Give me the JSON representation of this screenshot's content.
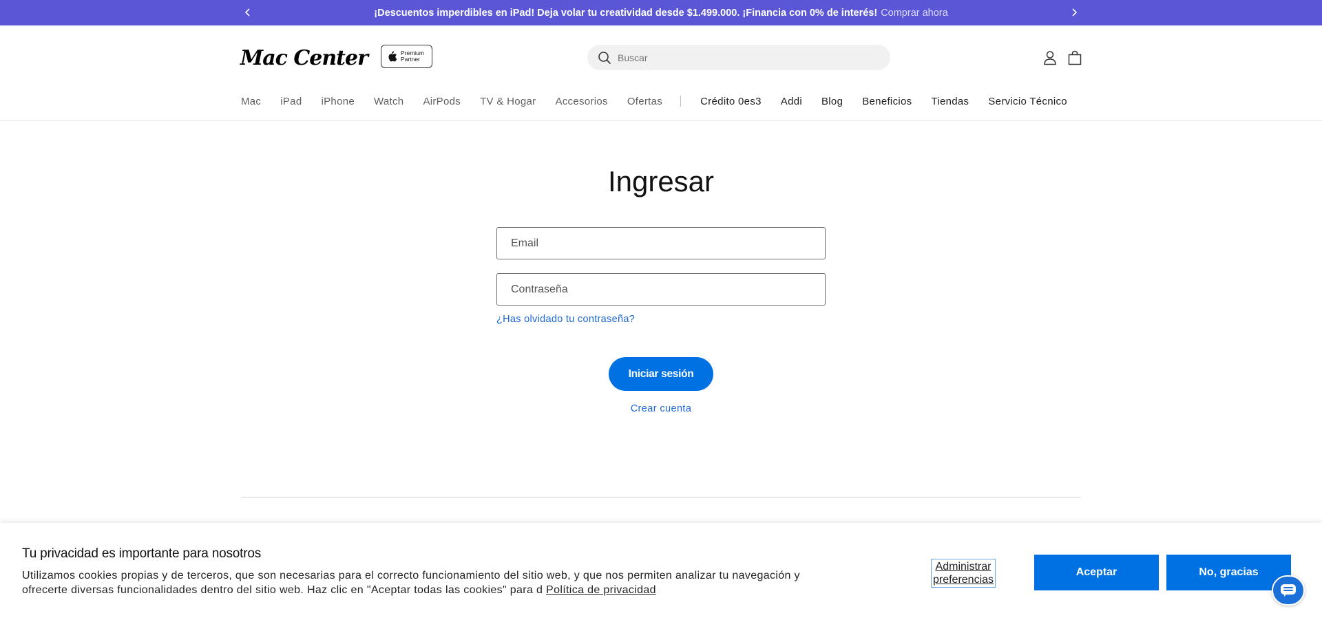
{
  "announcement": {
    "text": "¡Descuentos imperdibles en iPad! Deja volar tu creatividad desde $1.499.000. ¡Financia con 0% de interés!",
    "link": "Comprar ahora"
  },
  "header": {
    "logo": "Mac Center",
    "partner_badge": [
      "Premium",
      "Partner"
    ],
    "search_placeholder": "Buscar"
  },
  "nav": {
    "primary": [
      "Mac",
      "iPad",
      "iPhone",
      "Watch",
      "AirPods",
      "TV & Hogar",
      "Accesorios",
      "Ofertas"
    ],
    "secondary": [
      "Crédito 0es3",
      "Addi",
      "Blog",
      "Beneficios",
      "Tiendas",
      "Servicio Técnico"
    ]
  },
  "login": {
    "title": "Ingresar",
    "email_placeholder": "Email",
    "password_placeholder": "Contraseña",
    "forgot": "¿Has olvidado tu contraseña?",
    "submit": "Iniciar sesión",
    "create": "Crear cuenta"
  },
  "cookie": {
    "title": "Tu privacidad es importante para nosotros",
    "body": "Utilizamos cookies propias y de terceros, que son necesarias para el correcto funcionamiento del sitio web, y que nos permiten analizar tu navegación y ofrecerte diversas funcionalidades dentro del sitio web. Haz clic en \"Aceptar todas las cookies\" para d",
    "policy_link": "Política de privacidad",
    "prefs": "Administrar preferencias",
    "accept": "Aceptar",
    "reject": "No, gracias"
  }
}
